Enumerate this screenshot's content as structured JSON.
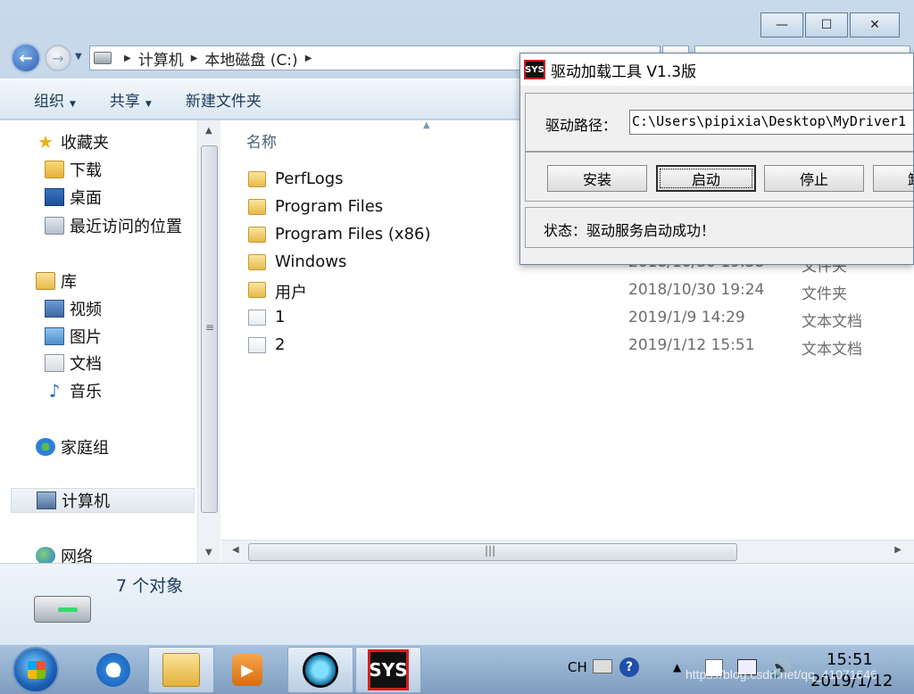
{
  "explorer": {
    "window_controls": {
      "minimize": "—",
      "maximize": "☐",
      "close": "✕"
    },
    "address": {
      "crumbs": [
        "计算机",
        "本地磁盘 (C:)"
      ]
    },
    "toolbar": {
      "organize": "组织",
      "share": "共享",
      "new_folder": "新建文件夹"
    },
    "nav": {
      "favorites": "收藏夹",
      "downloads": "下载",
      "desktop": "桌面",
      "recent": "最近访问的位置",
      "libraries": "库",
      "videos": "视频",
      "pictures": "图片",
      "documents": "文档",
      "music": "音乐",
      "homegroup": "家庭组",
      "computer": "计算机",
      "network": "网络"
    },
    "columns": {
      "name": "名称"
    },
    "files": [
      {
        "name": "PerfLogs",
        "date": "",
        "type": "",
        "icon": "folder-icon"
      },
      {
        "name": "Program Files",
        "date": "",
        "type": "",
        "icon": "folder-icon"
      },
      {
        "name": "Program Files (x86)",
        "date": "",
        "type": "",
        "icon": "folder-icon"
      },
      {
        "name": "Windows",
        "date": "2018/10/30 19:38",
        "type": "文件夹",
        "icon": "folder-icon"
      },
      {
        "name": "用户",
        "date": "2018/10/30 19:24",
        "type": "文件夹",
        "icon": "folder-icon"
      },
      {
        "name": "1",
        "date": "2019/1/9 14:29",
        "type": "文本文档",
        "icon": "text-file-icon"
      },
      {
        "name": "2",
        "date": "2019/1/12 15:51",
        "type": "文本文档",
        "icon": "text-file-icon"
      }
    ],
    "details": {
      "count": "7 个对象"
    }
  },
  "dialog": {
    "title": "驱动加载工具 V1.3版",
    "logo_text": "SYS",
    "path_label": "驱动路径：",
    "path_value": "C:\\Users\\pipixia\\Desktop\\MyDriver1",
    "buttons": {
      "install": "安装",
      "start": "启动",
      "stop": "停止",
      "uninstall": "卸"
    },
    "status": "状态：驱动服务启动成功！"
  },
  "taskbar": {
    "ie_letter": "e",
    "sys_app_label": "SYS",
    "tray": {
      "lang": "CH",
      "help": "?",
      "time": "15:51",
      "date": "2019/1/12"
    },
    "watermark": "https://blog.csdn.net/qq_41071646"
  },
  "colors": {
    "dialog_logo_border": "#d32020",
    "start_orb": "#1a5fb4"
  }
}
